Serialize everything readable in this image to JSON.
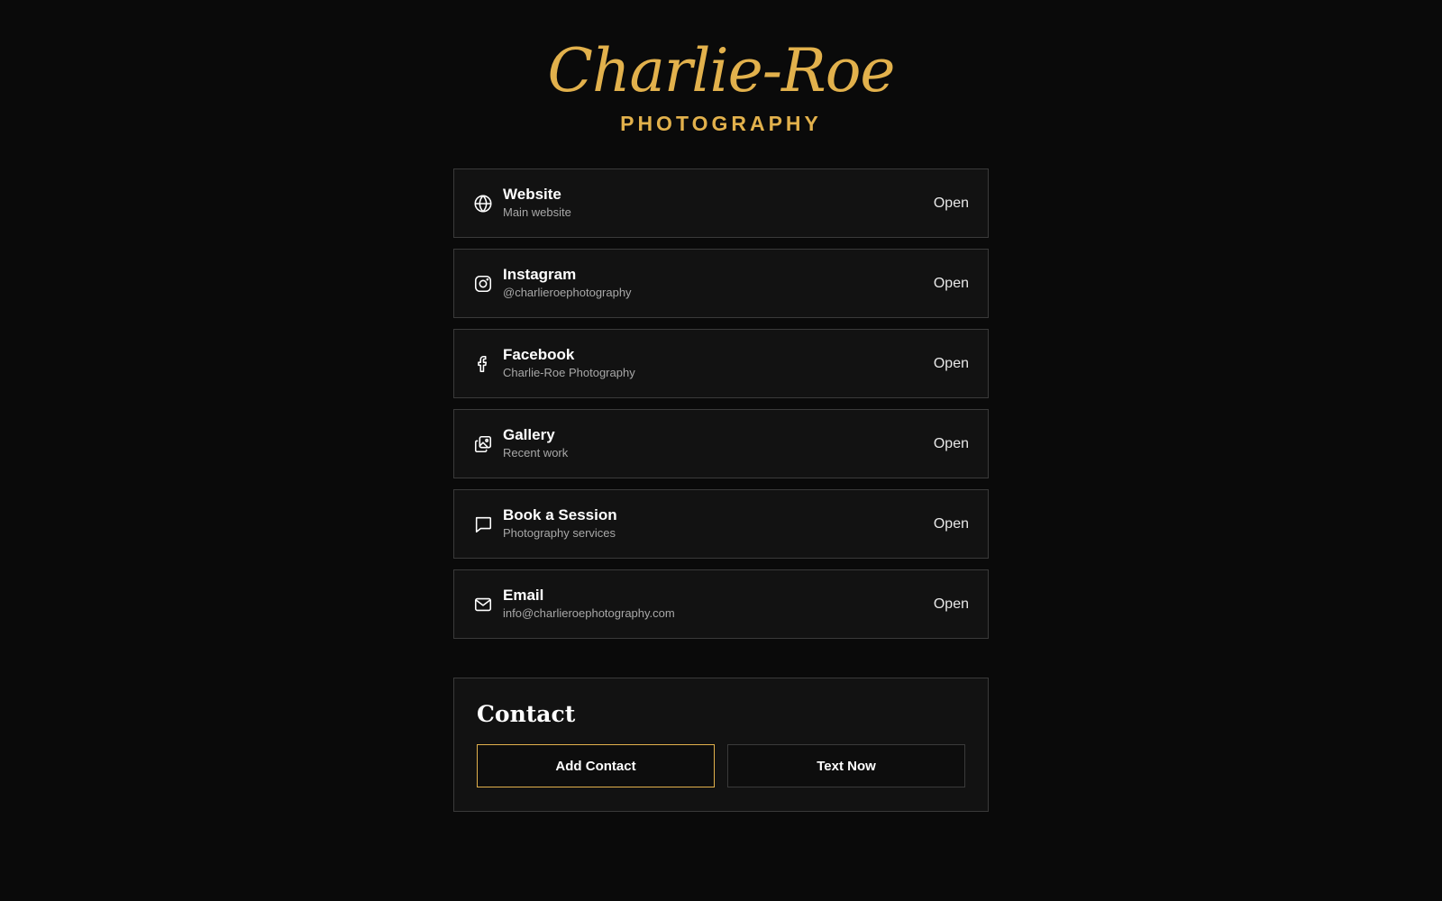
{
  "brand": {
    "script": "Charlie-Roe",
    "sub": "PHOTOGRAPHY",
    "accent_color": "#e2b14c"
  },
  "links": [
    {
      "icon": "globe-icon",
      "title": "Website",
      "subtitle": "Main website",
      "action": "Open"
    },
    {
      "icon": "instagram-icon",
      "title": "Instagram",
      "subtitle": "@charlieroephotography",
      "action": "Open"
    },
    {
      "icon": "facebook-icon",
      "title": "Facebook",
      "subtitle": "Charlie-Roe Photography",
      "action": "Open"
    },
    {
      "icon": "gallery-icon",
      "title": "Gallery",
      "subtitle": "Recent work",
      "action": "Open"
    },
    {
      "icon": "message-icon",
      "title": "Book a Session",
      "subtitle": "Photography services",
      "action": "Open"
    },
    {
      "icon": "mail-icon",
      "title": "Email",
      "subtitle": "info@charlieroephotography.com",
      "action": "Open"
    }
  ],
  "contact": {
    "title": "Contact",
    "add_contact_label": "Add Contact",
    "text_now_label": "Text Now"
  }
}
